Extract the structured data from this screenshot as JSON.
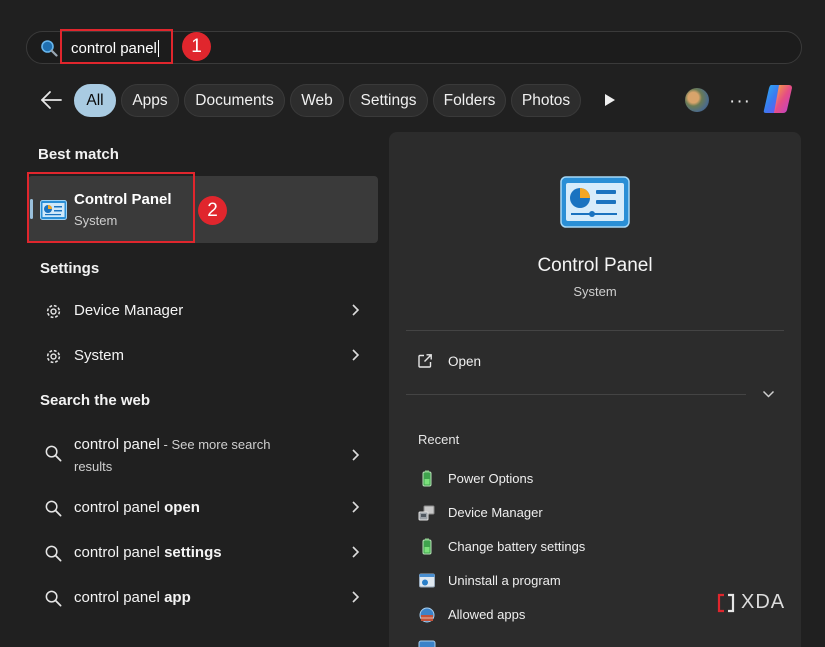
{
  "search": {
    "query": "control panel"
  },
  "annotations": {
    "step1": "1",
    "step2": "2"
  },
  "filters": [
    {
      "label": "All",
      "active": true
    },
    {
      "label": "Apps"
    },
    {
      "label": "Documents"
    },
    {
      "label": "Web"
    },
    {
      "label": "Settings"
    },
    {
      "label": "Folders"
    },
    {
      "label": "Photos"
    }
  ],
  "icons": {
    "search": "search-icon",
    "back": "arrow-left-icon",
    "play": "play-icon",
    "more": "more-icon",
    "copilot": "copilot-icon",
    "gear": "gear-icon",
    "chevron": "chevron-right-icon",
    "open": "open-external-icon"
  },
  "more_glyph": "···",
  "best_match": {
    "title": "Best match",
    "name": "Control Panel",
    "subtitle": "System"
  },
  "settings": {
    "title": "Settings",
    "items": [
      {
        "label": "Device Manager"
      },
      {
        "label": "System"
      }
    ]
  },
  "web": {
    "title": "Search the web",
    "items": [
      {
        "label": "control panel",
        "suffix": " - See more search",
        "suffix2": "results"
      },
      {
        "prefix": "control panel ",
        "bold": "open"
      },
      {
        "prefix": "control panel ",
        "bold": "settings"
      },
      {
        "prefix": "control panel ",
        "bold": "app"
      }
    ]
  },
  "detail": {
    "name": "Control Panel",
    "subtitle": "System",
    "open_label": "Open",
    "recent_title": "Recent",
    "recent": [
      {
        "label": "Power Options"
      },
      {
        "label": "Device Manager"
      },
      {
        "label": "Change battery settings"
      },
      {
        "label": "Uninstall a program"
      },
      {
        "label": "Allowed apps"
      }
    ]
  },
  "watermark": {
    "text": "XDA"
  },
  "colors": {
    "background": "#202020",
    "panel": "#2c2c2c",
    "chip_active": "#a9cbe2",
    "highlight_red": "#e0262d"
  }
}
